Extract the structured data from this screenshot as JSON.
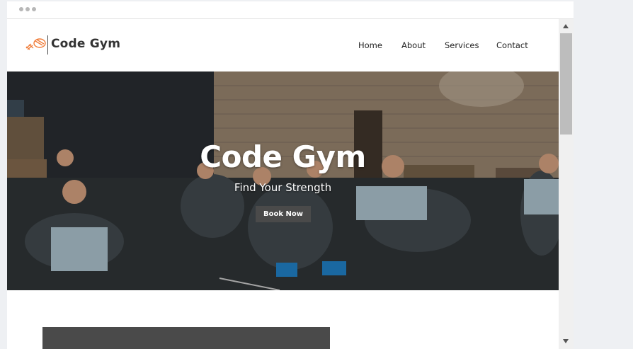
{
  "brand": {
    "name": "Code Gym"
  },
  "nav": {
    "items": [
      {
        "label": "Home"
      },
      {
        "label": "About"
      },
      {
        "label": "Services"
      },
      {
        "label": "Contact"
      }
    ]
  },
  "hero": {
    "title": "Code Gym",
    "subtitle": "Find Your Strength",
    "cta_label": "Book Now"
  },
  "icons": {
    "logo": "dumbbell-logo-icon",
    "scroll_up": "scroll-up-arrow-icon",
    "scroll_down": "scroll-down-arrow-icon"
  },
  "colors": {
    "logo_accent": "#f07d3a",
    "button_bg": "#4a4a4a",
    "text_dark": "#333333"
  }
}
